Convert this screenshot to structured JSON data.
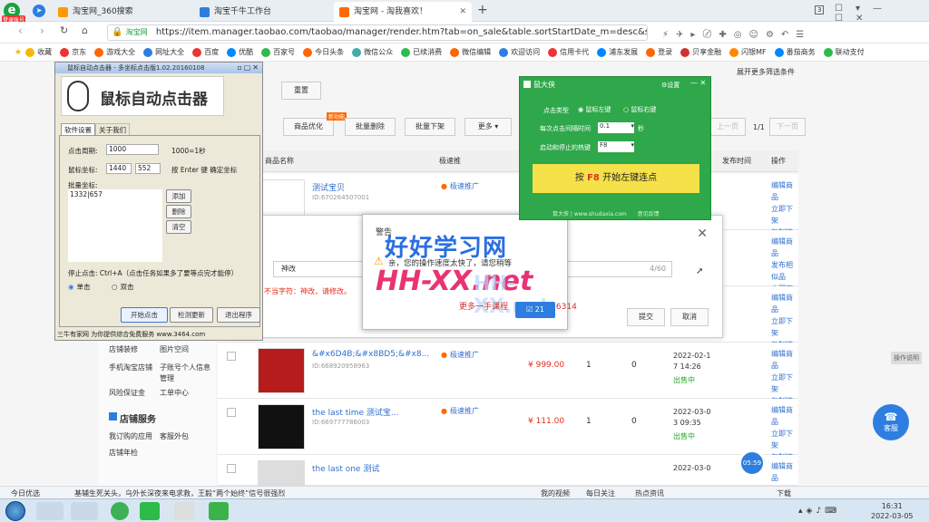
{
  "tabs": [
    {
      "label": "淘宝网_360搜索"
    },
    {
      "label": "淘宝千牛工作台"
    },
    {
      "label": "淘宝网 - 淘我喜欢！"
    }
  ],
  "browser": {
    "badge": "登录账号",
    "url_label": "淘宝网",
    "url": "https://item.manager.taobao.com/taobao/manager/render.htm?tab=on_sale&table.sortStartDate_m=desc&spm=a217",
    "tab_count": "3"
  },
  "bookmarks": [
    "收藏",
    "京东",
    "游戏大全",
    "网址大全",
    "百度",
    "优酷",
    "百家号",
    "今日头条",
    "微信公众",
    "已续消费",
    "微信编辑",
    "欢迎访问",
    "信用卡代",
    "浦东发展",
    "登录",
    "贝享金融",
    "闪银MF",
    "番茄商务",
    "联动支付"
  ],
  "page": {
    "toolbar": [
      "商品优化",
      "批量删除",
      "批量下架",
      "更多"
    ],
    "reset": "重置",
    "more_filter": "展开更多筛选条件",
    "prev": "上一页",
    "next": "下一页",
    "page_info": "1/1",
    "hot": "新功能",
    "headers": [
      "商品名称",
      "极速推",
      "价格",
      "库存",
      "销量",
      "发布时间",
      "操作"
    ],
    "rows": [
      {
        "title": "测试宝贝",
        "id": "ID:670264507001",
        "tag": "极速推广",
        "price": "",
        "stock": "",
        "sales": "",
        "date": "2022-03-0",
        "time": "5 14:14",
        "ops": [
          "编辑商品",
          "立即下架",
          "复制链接"
        ]
      },
      {
        "title": "",
        "id": "",
        "tag": "",
        "price": "",
        "stock": "",
        "sales": "",
        "date": "2022-03-0",
        "time": "4 14:45",
        "ops": [
          "编辑商品",
          "发布相似品",
          "立即下架"
        ]
      },
      {
        "title": "",
        "id": "",
        "tag": "",
        "price": "",
        "stock": "",
        "sales": "",
        "date": "2022-03-0",
        "time": "4 10:52",
        "ops": [
          "编辑商品",
          "立即下架",
          "复制链接"
        ]
      },
      {
        "title": "&#x6D4B;&#x8BD5;&#x8...",
        "id": "ID:668920958963",
        "tag": "极速推广",
        "price": "¥ 999.00",
        "stock": "1",
        "sales": "0",
        "date": "2022-02-1",
        "time": "7 14:26",
        "status": "出售中",
        "ops": [
          "编辑商品",
          "立即下架",
          "复制链接"
        ]
      },
      {
        "title": "the last time 测试宝...",
        "id": "ID:669777786003",
        "tag": "极速推广",
        "price": "¥ 111.00",
        "stock": "1",
        "sales": "0",
        "date": "2022-03-0",
        "time": "3 09:35",
        "status": "出售中",
        "ops": [
          "编辑商品",
          "立即下架",
          "复制链接"
        ]
      },
      {
        "title": "the last one 测试",
        "id": "",
        "tag": "",
        "price": "",
        "stock": "",
        "sales": "",
        "date": "2022-03-0",
        "time": "",
        "ops": [
          "编辑商品"
        ]
      }
    ],
    "sidebar": {
      "links": [
        [
          "店铺装修",
          "图片空间"
        ],
        [
          "手机淘宝店铺",
          "子账号个人信息管理"
        ],
        [
          "风险保证金",
          "工单中心"
        ]
      ],
      "section": "店铺服务",
      "links2": [
        [
          "我订购的应用",
          "客服外包"
        ],
        [
          "店铺年检",
          ""
        ]
      ]
    },
    "edit_dialog": {
      "value": "神改",
      "counter": "4/60",
      "hint": "不当字符：神改，请修改。",
      "confirm": "提交",
      "cancel": "取消"
    },
    "side_op": "操作说明",
    "service": "客服",
    "timer": "05:59"
  },
  "clicker": {
    "title": "鼠标自动点击器 - 多坐标点击版1.02.20160108",
    "logo": "鼠标自动点击器",
    "tabs": [
      "软件设置",
      "关于我们"
    ],
    "period_label": "点击周期:",
    "period": "1000",
    "period_note": "1000=1秒",
    "coord_label": "鼠标坐标:",
    "x": "1440",
    "y": "552",
    "coord_note": "按 Enter 键 确定坐标",
    "batch_label": "批量坐标:",
    "batch": "1332|657",
    "add": "添加",
    "del": "删除",
    "clear": "清空",
    "stop_label": "停止点击:",
    "stop_note": "Ctrl+A（点击任务如果多了要等点完才能停）",
    "single": "单击",
    "double": "双击",
    "start": "开始点击",
    "update": "检测更新",
    "quit": "退出程序",
    "footer": "三牛有家网 为你提供综合免费服务 www.3464.com"
  },
  "tool": {
    "title": "鼠大侠",
    "settings": "设置",
    "type_label": "点击类型",
    "left": "鼠标左键",
    "right": "鼠标右键",
    "interval_label": "每次点击间隔时间",
    "interval": "0.1",
    "unit": "秒",
    "hotkey_label": "启动和停止的热键",
    "hotkey": "F8",
    "main_pre": "按",
    "main_key": "F8",
    "main_post": "开始左键连点",
    "footer": "鼠大侠 | www.shudaxia.com",
    "feedback": "意见反馈"
  },
  "warning": {
    "title": "警告",
    "msg": "亲，您的操作速度太快了，请您稍等",
    "wm1": "好好学习网",
    "wm2": "HH-XX.net",
    "wm3": "更多一手课程",
    "wm_qq": "6314",
    "ok": "21"
  },
  "status": {
    "left": "今日优选",
    "news": "基辅生死关头，乌外长深夜来电求救，王毅“两个始终”信号很强烈",
    "video": "我的视频",
    "follow": "每日关注",
    "hot": "热点资讯",
    "down": "下载"
  },
  "taskbar": {
    "time": "16:31",
    "date": "2022-03-05"
  }
}
